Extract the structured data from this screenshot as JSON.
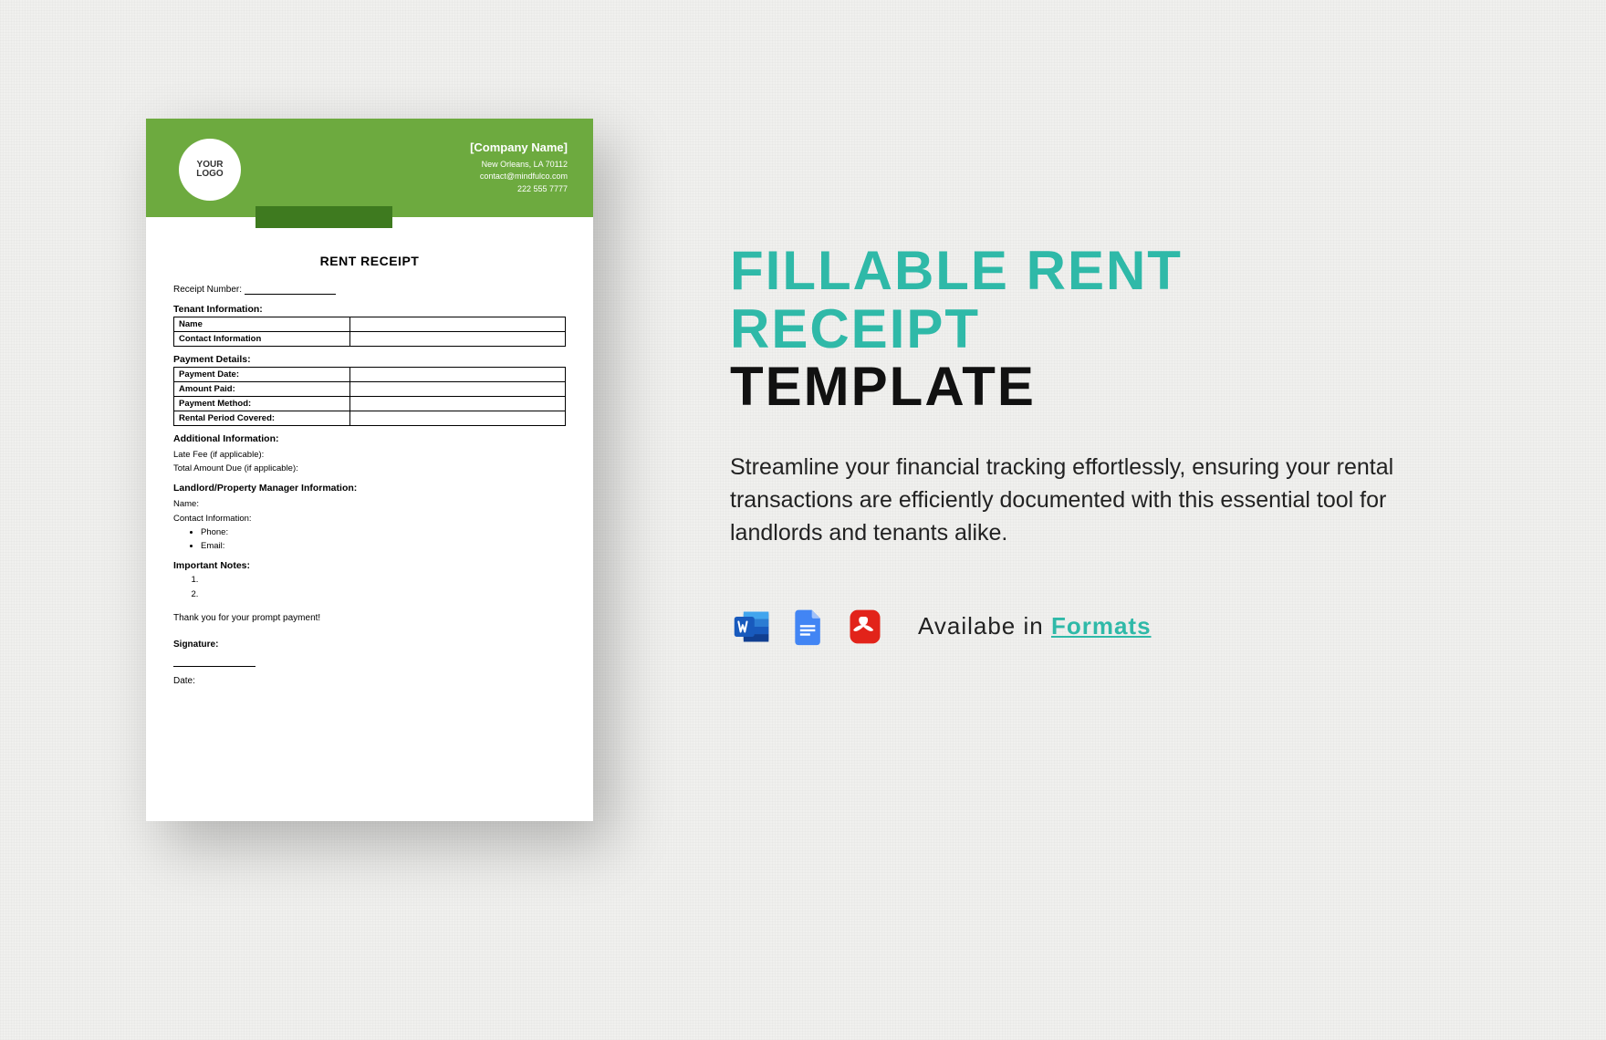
{
  "receipt": {
    "logo_text": "YOUR\nLOGO",
    "company_name": "[Company Name]",
    "company_addr": "New Orleans, LA 70112",
    "company_email": "contact@mindfulco.com",
    "company_phone": "222 555 7777",
    "title": "RENT RECEIPT",
    "receipt_number_label": "Receipt Number:",
    "tenant_section": "Tenant Information:",
    "tenant_rows": [
      "Name",
      "Contact Information"
    ],
    "payment_section": "Payment Details:",
    "payment_rows": [
      "Payment Date:",
      "Amount Paid:",
      "Payment Method:",
      "Rental Period Covered:"
    ],
    "additional_section": "Additional Information:",
    "late_fee_label": "Late Fee (if applicable):",
    "total_due_label": "Total Amount Due (if applicable):",
    "landlord_section": "Landlord/Property Manager Information:",
    "landlord_name_label": "Name:",
    "landlord_contact_label": "Contact Information:",
    "phone_label": "Phone:",
    "email_label": "Email:",
    "notes_section": "Important Notes:",
    "thankyou": "Thank you for your prompt payment!",
    "signature_label": "Signature:",
    "date_label": "Date:"
  },
  "promo": {
    "line1": "FILLABLE RENT",
    "line2": "RECEIPT",
    "line3": "TEMPLATE",
    "description": "Streamline your financial tracking effortlessly, ensuring your rental transactions are efficiently documented with this essential tool for landlords and tenants alike.",
    "available_prefix": "Availabe in ",
    "available_link": "Formats",
    "icons": [
      "word",
      "gdocs",
      "pdf"
    ]
  }
}
